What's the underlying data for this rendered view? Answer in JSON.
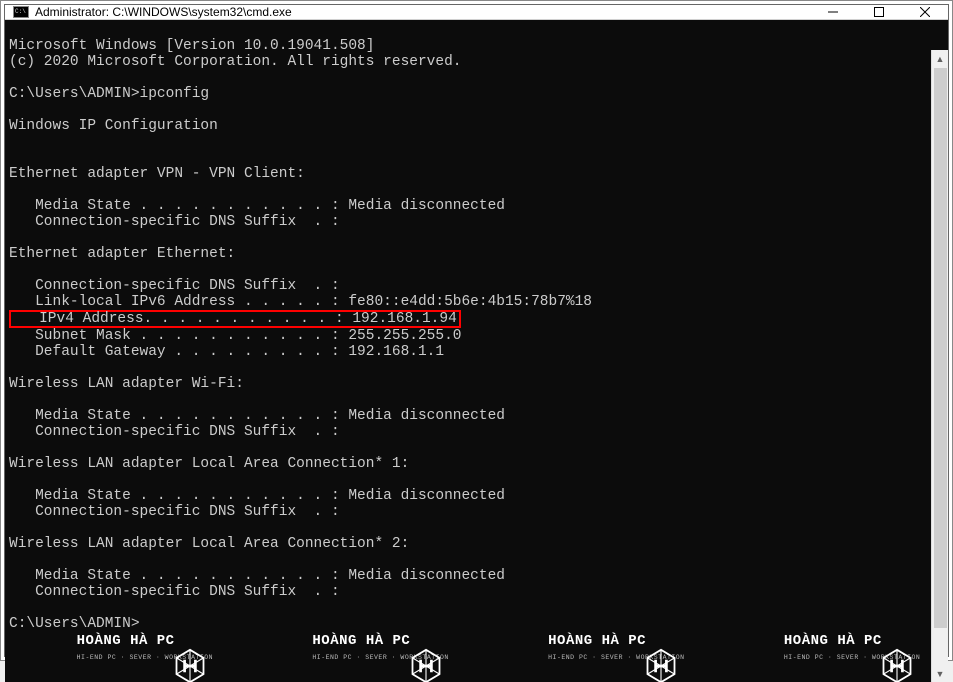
{
  "window": {
    "title": "Administrator: C:\\WINDOWS\\system32\\cmd.exe"
  },
  "terminal": {
    "line_version": "Microsoft Windows [Version 10.0.19041.508]",
    "line_copyright": "(c) 2020 Microsoft Corporation. All rights reserved.",
    "prompt1": "C:\\Users\\ADMIN>ipconfig",
    "header_ipconfig": "Windows IP Configuration",
    "adapter_vpn": "Ethernet adapter VPN - VPN Client:",
    "vpn_media": "   Media State . . . . . . . . . . . : Media disconnected",
    "vpn_dns": "   Connection-specific DNS Suffix  . :",
    "adapter_eth": "Ethernet adapter Ethernet:",
    "eth_dns": "   Connection-specific DNS Suffix  . :",
    "eth_ipv6": "   Link-local IPv6 Address . . . . . : fe80::e4dd:5b6e:4b15:78b7%18",
    "eth_ipv4": "   IPv4 Address. . . . . . . . . . . : 192.168.1.94",
    "eth_mask": "   Subnet Mask . . . . . . . . . . . : 255.255.255.0",
    "eth_gw": "   Default Gateway . . . . . . . . . : 192.168.1.1",
    "adapter_wifi": "Wireless LAN adapter Wi-Fi:",
    "wifi_media": "   Media State . . . . . . . . . . . : Media disconnected",
    "wifi_dns": "   Connection-specific DNS Suffix  . :",
    "adapter_lac1": "Wireless LAN adapter Local Area Connection* 1:",
    "lac1_media": "   Media State . . . . . . . . . . . : Media disconnected",
    "lac1_dns": "   Connection-specific DNS Suffix  . :",
    "adapter_lac2": "Wireless LAN adapter Local Area Connection* 2:",
    "lac2_media": "   Media State . . . . . . . . . . . : Media disconnected",
    "lac2_dns": "   Connection-specific DNS Suffix  . :",
    "prompt2": "C:\\Users\\ADMIN>"
  },
  "watermark": {
    "main": "HOÀNG HÀ PC",
    "sub": "HI-END PC · SEVER · WORKSTATION"
  }
}
